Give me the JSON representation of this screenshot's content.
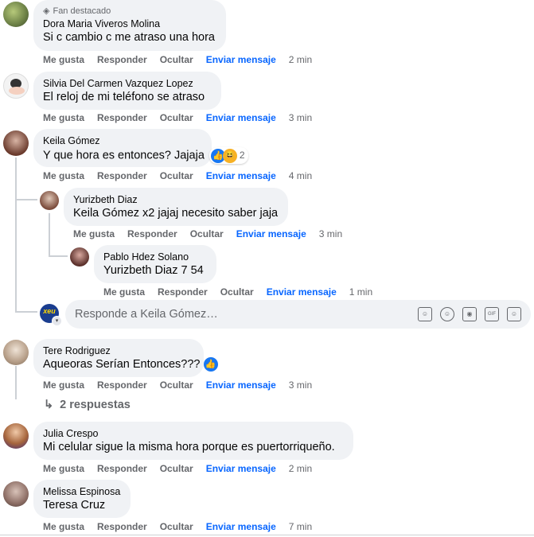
{
  "actions": {
    "like": "Me gusta",
    "reply": "Responder",
    "hide": "Ocultar",
    "send": "Enviar mensaje"
  },
  "comments": [
    {
      "badge": "Fan destacado",
      "author": "Dora Maria Viveros Molina",
      "text": "Si c cambio c me atraso una hora",
      "time": "2 min"
    },
    {
      "author": "Silvia Del Carmen Vazquez Lopez",
      "text": "El reloj de mi teléfono se atraso",
      "time": "3 min"
    },
    {
      "author": "Keila Gómez",
      "text": "Y que hora es entonces? Jajaja",
      "reaction_count": "2",
      "time": "4 min",
      "replies": [
        {
          "author": "Yurizbeth Diaz",
          "mention": "Keila Gómez",
          "text": " x2 jajaj necesito saber jaja",
          "time": "3 min"
        },
        {
          "author": "Pablo Hdez Solano",
          "mention": "Yurizbeth Diaz",
          "text": " 7 54",
          "time": "1 min"
        }
      ]
    },
    {
      "author": "Tere Rodriguez",
      "text": "Aqueoras Serían Entonces???",
      "time": "3 min",
      "more_replies": "2 respuestas"
    },
    {
      "author": "Julia Crespo",
      "text": "Mi celular sigue la misma hora porque es puertorriqueño.",
      "time": "2 min"
    },
    {
      "author": "Melissa Espinosa",
      "text": "Teresa Cruz",
      "time": "7 min"
    }
  ],
  "reply_box": {
    "placeholder": "Responde a Keila Gómez…",
    "avatar_label": "xeu"
  },
  "colors": {
    "link": "#0866ff",
    "bubble": "#f0f2f5",
    "muted": "#65676b"
  }
}
